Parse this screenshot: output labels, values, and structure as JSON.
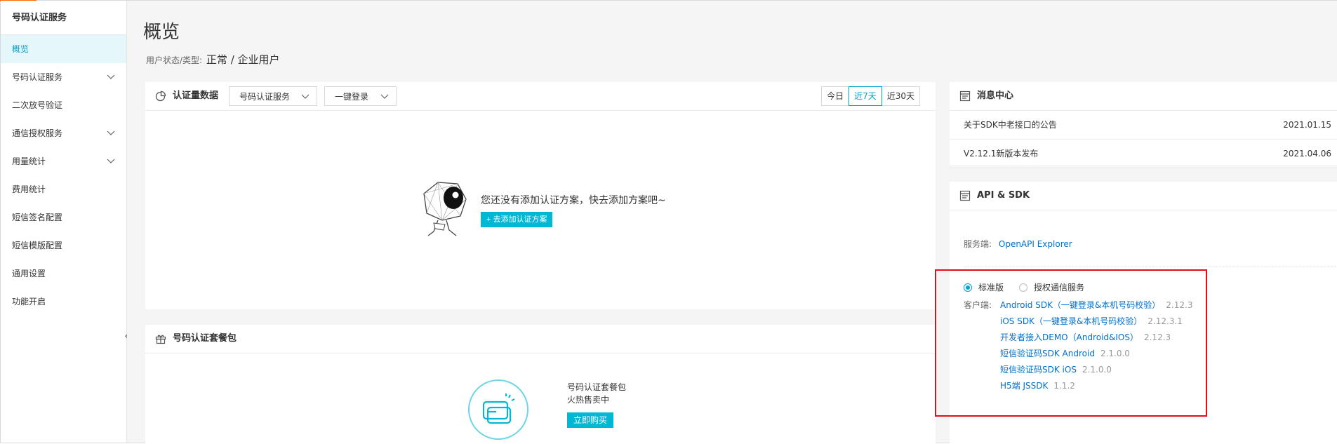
{
  "sidebar": {
    "title": "号码认证服务",
    "items": [
      {
        "label": "概览",
        "active": true,
        "has_children": false
      },
      {
        "label": "号码认证服务",
        "active": false,
        "has_children": true
      },
      {
        "label": "二次放号验证",
        "active": false,
        "has_children": false
      },
      {
        "label": "通信授权服务",
        "active": false,
        "has_children": true
      },
      {
        "label": "用量统计",
        "active": false,
        "has_children": true
      },
      {
        "label": "费用统计",
        "active": false,
        "has_children": false
      },
      {
        "label": "短信签名配置",
        "active": false,
        "has_children": false
      },
      {
        "label": "短信模版配置",
        "active": false,
        "has_children": false
      },
      {
        "label": "通用设置",
        "active": false,
        "has_children": false
      },
      {
        "label": "功能开启",
        "active": false,
        "has_children": false
      }
    ],
    "collapse_glyph": "«"
  },
  "header": {
    "title": "概览",
    "status_label": "用户状态/类型:",
    "status_value": "正常 / 企业用户"
  },
  "stats_card": {
    "title": "认证量数据",
    "service_select": "号码认证服务",
    "mode_select": "一键登录",
    "ranges": [
      {
        "label": "今日",
        "active": false
      },
      {
        "label": "近7天",
        "active": true
      },
      {
        "label": "近30天",
        "active": false
      }
    ],
    "empty_text": "您还没有添加认证方案，快去添加方案吧~",
    "add_button": "+ 去添加认证方案"
  },
  "package_card": {
    "title": "号码认证套餐包",
    "name": "号码认证套餐包",
    "subtitle": "火热售卖中",
    "buy_button": "立即购买"
  },
  "messages": {
    "title": "消息中心",
    "items": [
      {
        "text": "关于SDK中老接口的公告",
        "date": "2021.01.15"
      },
      {
        "text": "V2.12.1新版本发布",
        "date": "2021.04.06"
      }
    ]
  },
  "api_sdk": {
    "title": "API & SDK",
    "server_label": "服务端:",
    "server_link": "OpenAPI Explorer",
    "editions": [
      {
        "label": "标准版",
        "checked": true
      },
      {
        "label": "授权通信服务",
        "checked": false
      }
    ],
    "client_label": "客户端:",
    "sdks": [
      {
        "name": "Android SDK（一键登录&本机号码校验）",
        "version": "2.12.3"
      },
      {
        "name": "iOS SDK（一键登录&本机号码校验）",
        "version": "2.12.3.1"
      },
      {
        "name": "开发者接入DEMO（Android&IOS）",
        "version": "2.12.3"
      },
      {
        "name": "短信验证码SDK Android",
        "version": "2.1.0.0"
      },
      {
        "name": "短信验证码SDK iOS",
        "version": "2.1.0.0"
      },
      {
        "name": "H5端 JSSDK",
        "version": "1.1.2"
      }
    ]
  },
  "colors": {
    "accent": "#00a2ca",
    "button": "#00b8d4",
    "link": "#0070cc",
    "highlight": "#e01010",
    "brand_tab": "#ff6a00"
  }
}
